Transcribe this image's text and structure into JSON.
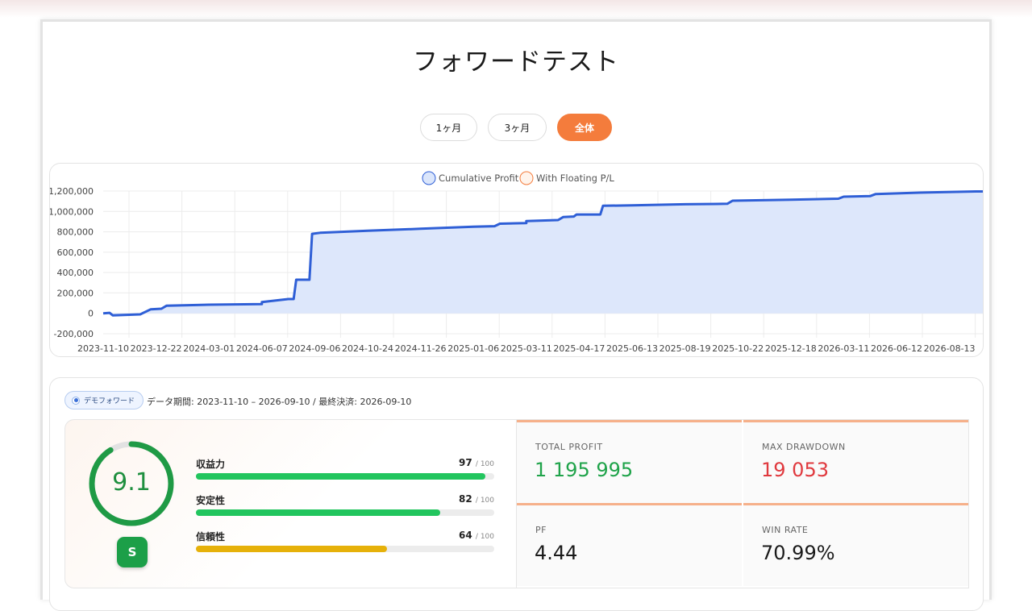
{
  "page": {
    "title": "フォワードテスト"
  },
  "tabs": [
    {
      "label": "1ヶ月",
      "active": false
    },
    {
      "label": "3ヶ月",
      "active": false
    },
    {
      "label": "全体",
      "active": true
    }
  ],
  "colors": {
    "accent": "#f47c3c",
    "series_line": "#2f5fd6",
    "series_fill": "#dde7fb",
    "positive": "#1fa34a",
    "negative": "#e0393e",
    "reliability": "#e6b10a"
  },
  "chart_data": {
    "type": "area",
    "legend": [
      "Cumulative Profit",
      "With Floating P/L"
    ],
    "legend_position": "top-center",
    "y_ticks": [
      "1,200,000",
      "1,000,000",
      "800,000",
      "600,000",
      "400,000",
      "200,000",
      "0",
      "-200,000"
    ],
    "x_ticks": [
      "2023-11-10",
      "2023-12-22",
      "2024-03-01",
      "2024-06-07",
      "2024-09-06",
      "2024-10-24",
      "2024-11-26",
      "2025-01-06",
      "2025-03-11",
      "2025-04-17",
      "2025-06-13",
      "2025-08-19",
      "2025-10-22",
      "2025-12-18",
      "2026-03-11",
      "2026-06-12",
      "2026-08-13"
    ],
    "ylim": [
      -200000,
      1200000
    ],
    "grid": true,
    "series": [
      {
        "name": "Cumulative Profit",
        "points": [
          [
            0,
            0
          ],
          [
            0.12,
            5000
          ],
          [
            0.18,
            -20000
          ],
          [
            0.7,
            -10000
          ],
          [
            0.9,
            40000
          ],
          [
            1.1,
            45000
          ],
          [
            1.2,
            75000
          ],
          [
            2.0,
            85000
          ],
          [
            3.0,
            90000
          ],
          [
            3.0,
            110000
          ],
          [
            3.5,
            140000
          ],
          [
            3.6,
            140000
          ],
          [
            3.65,
            330000
          ],
          [
            3.9,
            330000
          ],
          [
            3.95,
            780000
          ],
          [
            4.1,
            790000
          ],
          [
            5.0,
            810000
          ],
          [
            6.0,
            830000
          ],
          [
            7.0,
            850000
          ],
          [
            7.4,
            855000
          ],
          [
            7.5,
            880000
          ],
          [
            8.0,
            885000
          ],
          [
            8.0,
            905000
          ],
          [
            8.6,
            915000
          ],
          [
            8.7,
            945000
          ],
          [
            8.9,
            950000
          ],
          [
            8.95,
            970000
          ],
          [
            9.4,
            970000
          ],
          [
            9.45,
            1055000
          ],
          [
            10.0,
            1060000
          ],
          [
            11.0,
            1070000
          ],
          [
            11.8,
            1075000
          ],
          [
            11.9,
            1105000
          ],
          [
            13.0,
            1115000
          ],
          [
            13.9,
            1125000
          ],
          [
            14.0,
            1145000
          ],
          [
            14.5,
            1150000
          ],
          [
            14.6,
            1170000
          ],
          [
            15.5,
            1185000
          ],
          [
            16.5,
            1196000
          ]
        ]
      },
      {
        "name": "With Floating P/L",
        "points": []
      }
    ]
  },
  "stats": {
    "badge": "デモフォワード",
    "period": "データ期間: 2023-11-10 – 2026-09-10 / 最終決済: 2026-09-10",
    "score": "9.1",
    "score_fraction": 0.91,
    "grade": "S",
    "metrics": [
      {
        "label": "収益力",
        "value": "97",
        "max": "/ 100",
        "fraction": 0.97,
        "color": "#22c55e"
      },
      {
        "label": "安定性",
        "value": "82",
        "max": "/ 100",
        "fraction": 0.82,
        "color": "#22c55e"
      },
      {
        "label": "信頼性",
        "value": "64",
        "max": "/ 100",
        "fraction": 0.64,
        "color": "#e6b10a"
      }
    ],
    "kpis": [
      {
        "label": "TOTAL PROFIT",
        "value": "1 195 995",
        "color": "#1fa34a"
      },
      {
        "label": "MAX DRAWDOWN",
        "value": "19 053",
        "color": "#e0393e"
      },
      {
        "label": "PF",
        "value": "4.44",
        "color": "#1a1a1a"
      },
      {
        "label": "WIN RATE",
        "value": "70.99%",
        "color": "#1a1a1a"
      }
    ]
  }
}
